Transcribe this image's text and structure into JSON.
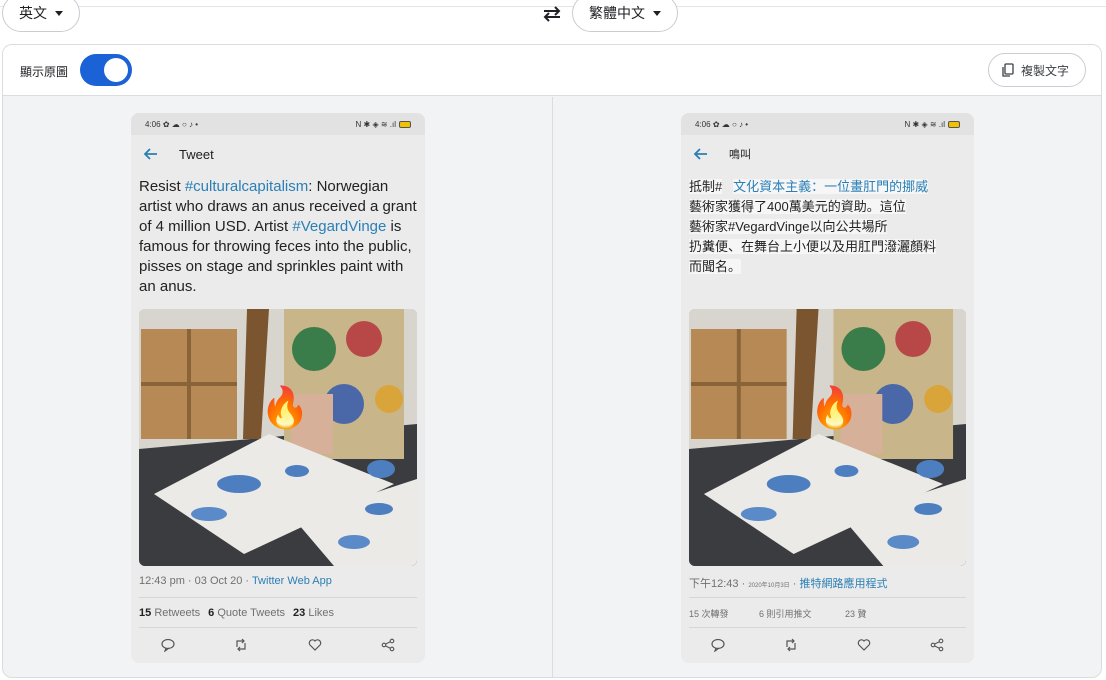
{
  "lang_bar": {
    "source_lang": "英文",
    "target_lang": "繁體中文"
  },
  "card": {
    "show_original_label": "顯示原圖",
    "show_original_on": true,
    "copy_button_label": "複製文字"
  },
  "original": {
    "status_time": "4:06",
    "status_icons_left": "✿ ☁ ○ ♪ •",
    "status_icons_right": "N ✱ ◈ ≋ .ıl",
    "nav_title": "Tweet",
    "text_pre": "Resist ",
    "hashtag1": "#culturalcapitalism",
    "text_mid": ": Norwegian artist who draws an anus received a grant of 4 million USD. Artist ",
    "hashtag2": "#VegardVinge",
    "text_post": " is famous for throwing feces into the public, pisses on stage and sprinkles paint with an anus.",
    "meta_time": "12:43 pm",
    "meta_date": "03 Oct 20",
    "meta_source": "Twitter Web App",
    "retweets_count": "15",
    "retweets_label": "Retweets",
    "quotes_count": "6",
    "quotes_label": "Quote Tweets",
    "likes_count": "23",
    "likes_label": "Likes",
    "overlay_emoji": "🔥"
  },
  "translated": {
    "status_time": "4:06",
    "status_icons_left": "✿ ☁ ○ ♪ •",
    "status_icons_right": "N ✱ ◈ ≋ .ıl",
    "nav_title": "鳴叫",
    "line1_pre": "抵制#",
    "line1_tag": "文化資本主義：一位畫肛門的挪威",
    "line2": "藝術家獲得了400萬美元的資助。這位",
    "line3": "藝術家#VegardVinge以向公共場所",
    "line4": "扔糞便、在舞台上小便以及用肛門潑灑顏料",
    "line5": "而聞名。",
    "meta_time": "下午12:43",
    "meta_date": "2020年10月3日",
    "meta_source": "推特網路應用程式",
    "retweets": "15 次轉發",
    "quotes": "6 則引用推文",
    "likes": "23 贊",
    "overlay_emoji": "🔥"
  },
  "colors": {
    "accent": "#1a62d6",
    "hashtag": "#2a7fb6",
    "panel_bg": "#f1f3f4"
  }
}
